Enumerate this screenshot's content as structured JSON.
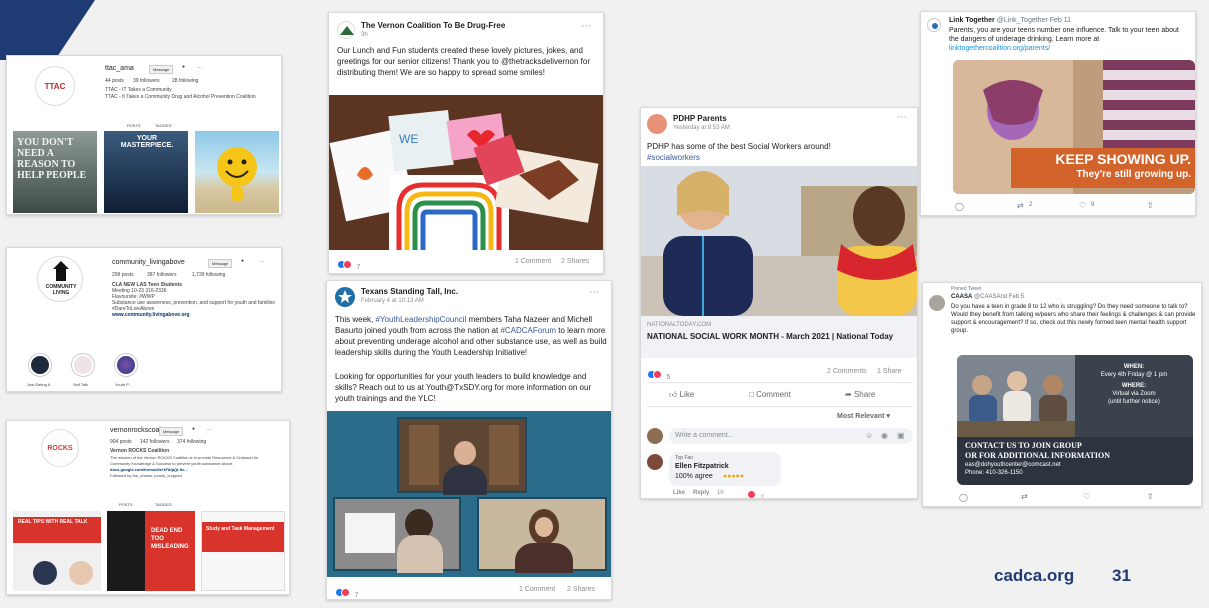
{
  "footer": {
    "site": "cadca.org",
    "page": "31"
  },
  "ig1": {
    "logo": "TTAC",
    "username": "ttac_ama",
    "message_btn": "Message",
    "stats": [
      "44 posts",
      "39 followers",
      "28 following"
    ],
    "bio": [
      "TTAC - IT Takes a Community",
      "TTAC - It Takes a Community Drug and Alcohol Prevention Coalition"
    ],
    "tabs": [
      "POSTS",
      "TAGGED"
    ],
    "posts": [
      "YOU DON'T NEED A REASON TO HELP PEOPLE",
      "YOUR MASTERPIECE.",
      ""
    ]
  },
  "ig2": {
    "logo": "COMMUNITY LIVING",
    "username": "community_livingabove",
    "message_btn": "Message",
    "stats": [
      "299 posts",
      "387 followers",
      "1,739 following"
    ],
    "bio": [
      "CLA NEW LAS Teen Students",
      "Meeting 10-23 316-2336",
      "Flavoursite: #WWP",
      "Substance use awareness, prevention, and support for youth and families",
      "#DareToLiveAbove",
      "www.community.livingabove.org"
    ],
    "highlights": [
      "Just Eating It",
      "Self Talk",
      "Youth P..."
    ]
  },
  "ig3": {
    "logo": "ROCKS",
    "username": "vernonrockscoal",
    "message_btn": "Message",
    "stats": [
      "904 posts",
      "142 followers",
      "374 following"
    ],
    "bio": [
      "Vernon ROCKS Coalition",
      "The mission of the Vernon ROCKS Coalition is to provide Resources & Outreach for",
      "Community Knowledge & Success to prevent youth substance abuse.",
      "docs.google.com/forms/d/e/1FAIpQLSc...",
      "Followed by the_chams, poorly_cropped"
    ],
    "tabs": [
      "POSTS",
      "TAGGED"
    ],
    "posts": [
      "REAL TIPS WITH REAL TALK",
      "DEAD END TOO MISLEADING",
      "Study and Task Management"
    ]
  },
  "fb1": {
    "page_name": "The Vernon Coalition To Be Drug-Free",
    "time": "3h",
    "text": "Our Lunch and Fun students created these lovely pictures, jokes, and greetings for our senior citizens! Thank you to @thetracksdelivernon for distributing them! We are so happy to spread some smiles!",
    "reaction_count": "7",
    "comments": "1 Comment",
    "shares": "2 Shares"
  },
  "fb2": {
    "page_name": "Texans Standing Tall, Inc.",
    "time": "February 4 at 10:13 AM",
    "text_parts": [
      "This week, ",
      "#YouthLeadershipCouncil",
      " members Taha Nazeer and Michell Basurto joined youth from across the nation at ",
      "#CADCAForum",
      " to learn more about preventing underage alcohol and other substance use, as well as build leadership skills during the Youth Leadership Initiative!"
    ],
    "text2": "Looking for opportunities for your youth leaders to build knowledge and skills? Reach out to us at Youth@TxSDY.org for more information on our youth trainings and the YLC!",
    "reaction_count": "7",
    "comments": "1 Comment",
    "shares": "2 Shares"
  },
  "fb3": {
    "page_name": "PDHP Parents",
    "time": "Yesterday at 8:53 AM",
    "text": "PDHP has some of the best Social Workers around!",
    "hashtag": "#socialworkers",
    "link_domain": "NATIONALTODAY.COM",
    "link_title": "NATIONAL SOCIAL WORK MONTH - March 2021 | National Today",
    "reaction_count": "5",
    "comments": "2 Comments",
    "shares": "1 Share",
    "actions": [
      "Like",
      "Comment",
      "Share"
    ],
    "sort": "Most Relevant",
    "comment_placeholder": "Write a comment...",
    "comment_badge": "Top Fan",
    "comment_author": "Ellen Fitzpatrick",
    "comment_text": "100% agree",
    "comment_actions": [
      "Like",
      "Reply",
      "1h"
    ],
    "comment_reacts": "2"
  },
  "tw1": {
    "name": "Link Together",
    "handle": "@Link_Together",
    "date": "Feb 11",
    "text": "Parents, you are your teens number one influence. Talk to your teen about the dangers of underage drinking. Learn more at",
    "link": "linktogethercoalition.org/parents/",
    "image_line1": "KEEP SHOWING UP.",
    "image_line2": "They're still growing up.",
    "retweets": "2",
    "likes": "9"
  },
  "tw2": {
    "pinned": "Pinned Tweet",
    "name": "CAASA",
    "handle": "@CAASAnd",
    "date": "Feb 5",
    "text": "Do you have a teen in grade 8 to 12 who is struggling? Do they need someone to talk to? Would they benefit from talking w/peers who share their feelings & challenges & can provide support & encouragement? If so, check out this newly formed teen mental health support group.",
    "flyer_when": "WHEN:",
    "flyer_when_val": "Every 4th Friday @ 1 pm",
    "flyer_where": "WHERE:",
    "flyer_where_val": "Virtual via Zoom",
    "flyer_note": "(until further notice)",
    "flyer_contact1": "CONTACT US TO JOIN GROUP",
    "flyer_contact2": "OR FOR ADDITIONAL INFORMATION",
    "flyer_email": "eas@dohyouthcenter@comcast.net",
    "flyer_phone": "Phone: 410-326-1150"
  },
  "colors": {
    "navy": "#1f3b73",
    "fb_blue": "#1877f2",
    "link_blue": "#385898",
    "orange": "#d2632b"
  }
}
